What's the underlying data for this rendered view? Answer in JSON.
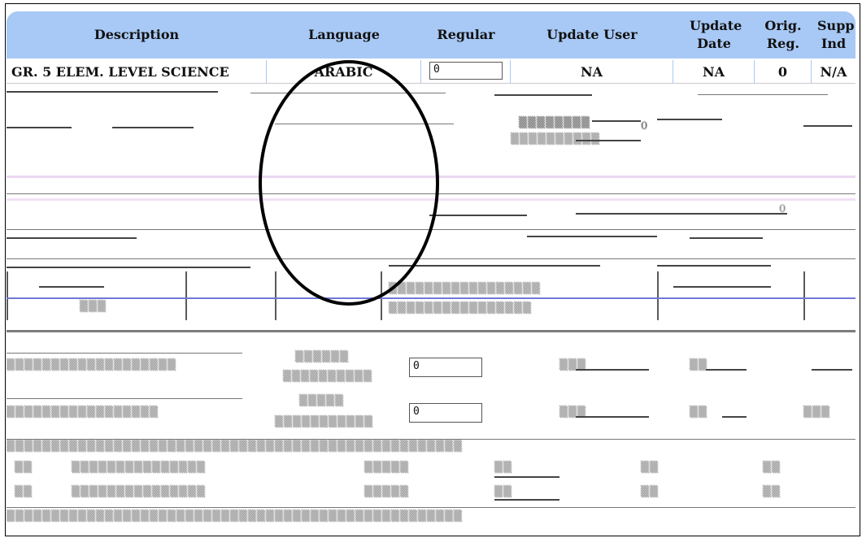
{
  "table": {
    "headers": {
      "description": "Description",
      "language": "Language",
      "regular": "Regular",
      "update_user": "Update User",
      "update_date": "Update Date",
      "orig_reg": "Orig. Reg.",
      "supp_ind": "Supp Ind"
    },
    "first_row": {
      "description": "GR. 5 ELEM. LEVEL SCIENCE",
      "language": "ARABIC",
      "regular": "0",
      "update_user": "NA",
      "update_date": "NA",
      "orig_reg": "0",
      "supp_ind": "N/A"
    },
    "visible_fragments": [
      {
        "text": "0"
      },
      {
        "text": "0"
      },
      {
        "text": "0"
      },
      {
        "text": "0"
      }
    ]
  },
  "colors": {
    "header_bg": "#a8c9f5",
    "annotation_circle": "#000000"
  }
}
